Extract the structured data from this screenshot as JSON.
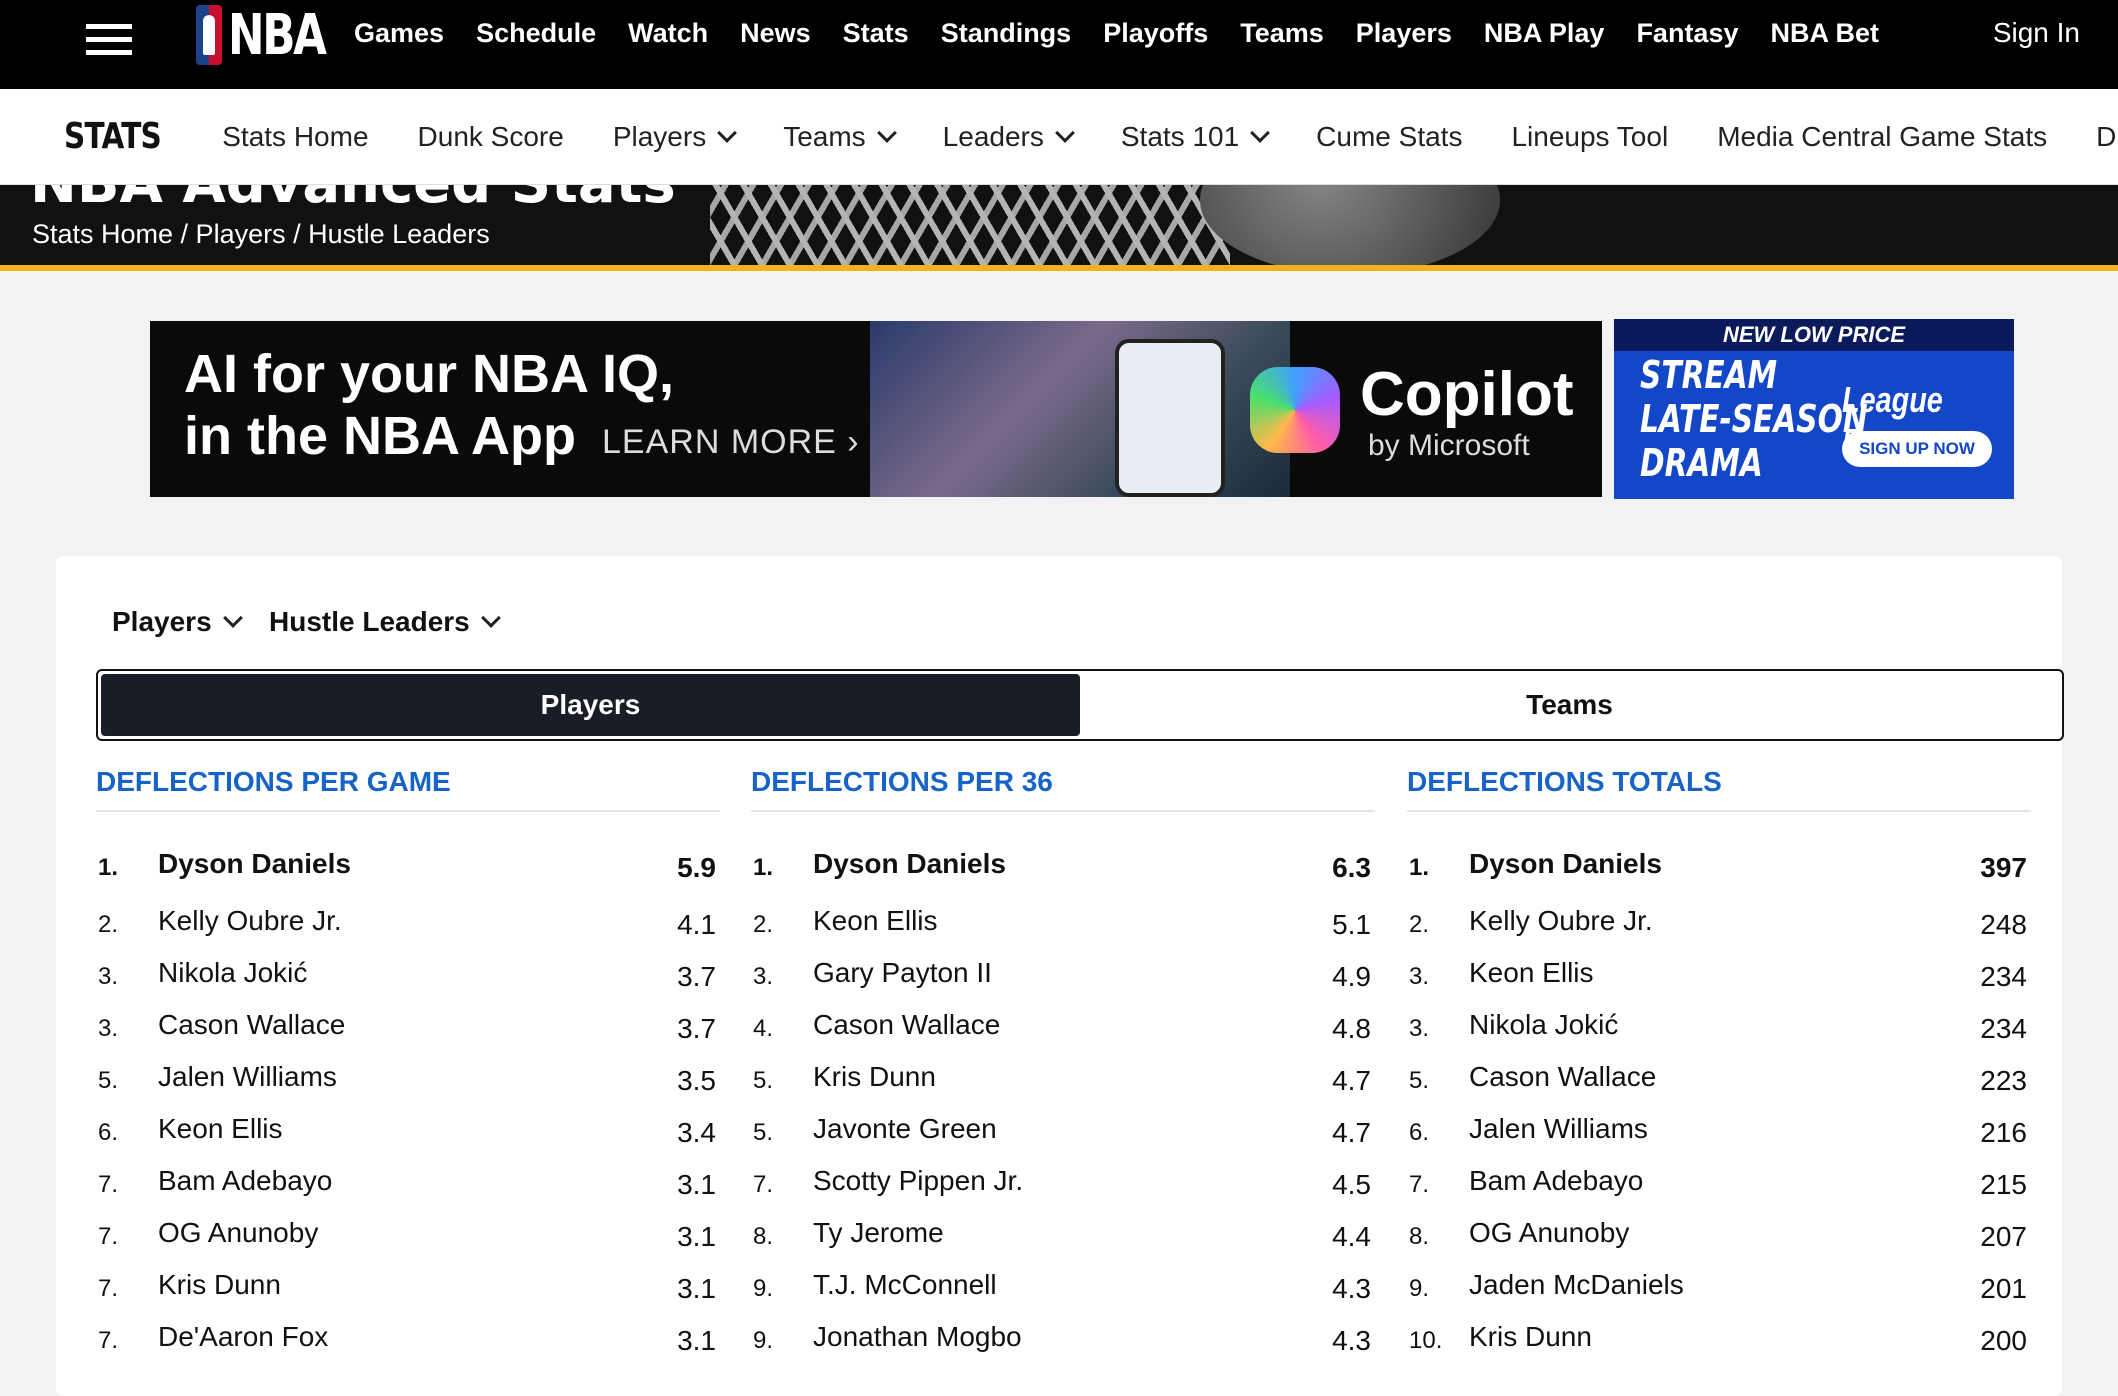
{
  "topnav": {
    "logo": "NBA",
    "links": [
      "Games",
      "Schedule",
      "Watch",
      "News",
      "Stats",
      "Standings",
      "Playoffs",
      "Teams",
      "Players",
      "NBA Play",
      "Fantasy",
      "NBA Bet"
    ],
    "signin": "Sign In"
  },
  "subnav": {
    "logo": "STATS",
    "items": [
      {
        "label": "Stats Home"
      },
      {
        "label": "Dunk Score"
      },
      {
        "label": "Players"
      },
      {
        "label": "Teams"
      },
      {
        "label": "Leaders"
      },
      {
        "label": "Stats 101"
      },
      {
        "label": "Cume Stats"
      },
      {
        "label": "Lineups Tool"
      },
      {
        "label": "Media Central Game Stats"
      },
      {
        "label": "D"
      }
    ]
  },
  "hero": {
    "title": "NBA Advanced Stats",
    "breadcrumb": "Stats Home / Players / Hustle Leaders"
  },
  "ads": {
    "ad1_line1": "AI for your NBA IQ,",
    "ad1_line2": "in the NBA App",
    "ad1_learn": "LEARN MORE ›",
    "ad1_brand": "Copilot",
    "ad1_brand_sub": "by Microsoft",
    "ad2_top": "NEW LOW PRICE",
    "ad2_line1": "STREAM",
    "ad2_line2": "LATE-SEASON",
    "ad2_line3": "DRAMA",
    "ad2_brand": "League Pass",
    "ad2_button": "SIGN UP NOW"
  },
  "filters": {
    "category": "Players",
    "stat": "Hustle Leaders"
  },
  "toggle": {
    "players": "Players",
    "teams": "Teams"
  },
  "columns": [
    {
      "title": "DEFLECTIONS PER GAME",
      "rows": [
        {
          "rank": "1.",
          "name": "Dyson Daniels",
          "value": "5.9"
        },
        {
          "rank": "2.",
          "name": "Kelly Oubre Jr.",
          "value": "4.1"
        },
        {
          "rank": "3.",
          "name": "Nikola Jokić",
          "value": "3.7"
        },
        {
          "rank": "3.",
          "name": "Cason Wallace",
          "value": "3.7"
        },
        {
          "rank": "5.",
          "name": "Jalen Williams",
          "value": "3.5"
        },
        {
          "rank": "6.",
          "name": "Keon Ellis",
          "value": "3.4"
        },
        {
          "rank": "7.",
          "name": "Bam Adebayo",
          "value": "3.1"
        },
        {
          "rank": "7.",
          "name": "OG Anunoby",
          "value": "3.1"
        },
        {
          "rank": "7.",
          "name": "Kris Dunn",
          "value": "3.1"
        },
        {
          "rank": "7.",
          "name": "De'Aaron Fox",
          "value": "3.1"
        }
      ]
    },
    {
      "title": "DEFLECTIONS PER 36",
      "rows": [
        {
          "rank": "1.",
          "name": "Dyson Daniels",
          "value": "6.3"
        },
        {
          "rank": "2.",
          "name": "Keon Ellis",
          "value": "5.1"
        },
        {
          "rank": "3.",
          "name": "Gary Payton II",
          "value": "4.9"
        },
        {
          "rank": "4.",
          "name": "Cason Wallace",
          "value": "4.8"
        },
        {
          "rank": "5.",
          "name": "Kris Dunn",
          "value": "4.7"
        },
        {
          "rank": "5.",
          "name": "Javonte Green",
          "value": "4.7"
        },
        {
          "rank": "7.",
          "name": "Scotty Pippen Jr.",
          "value": "4.5"
        },
        {
          "rank": "8.",
          "name": "Ty Jerome",
          "value": "4.4"
        },
        {
          "rank": "9.",
          "name": "T.J. McConnell",
          "value": "4.3"
        },
        {
          "rank": "9.",
          "name": "Jonathan Mogbo",
          "value": "4.3"
        }
      ]
    },
    {
      "title": "DEFLECTIONS TOTALS",
      "rows": [
        {
          "rank": "1.",
          "name": "Dyson Daniels",
          "value": "397"
        },
        {
          "rank": "2.",
          "name": "Kelly Oubre Jr.",
          "value": "248"
        },
        {
          "rank": "3.",
          "name": "Keon Ellis",
          "value": "234"
        },
        {
          "rank": "3.",
          "name": "Nikola Jokić",
          "value": "234"
        },
        {
          "rank": "5.",
          "name": "Cason Wallace",
          "value": "223"
        },
        {
          "rank": "6.",
          "name": "Jalen Williams",
          "value": "216"
        },
        {
          "rank": "7.",
          "name": "Bam Adebayo",
          "value": "215"
        },
        {
          "rank": "8.",
          "name": "OG Anunoby",
          "value": "207"
        },
        {
          "rank": "9.",
          "name": "Jaden McDaniels",
          "value": "201"
        },
        {
          "rank": "10.",
          "name": "Kris Dunn",
          "value": "200"
        }
      ]
    }
  ]
}
